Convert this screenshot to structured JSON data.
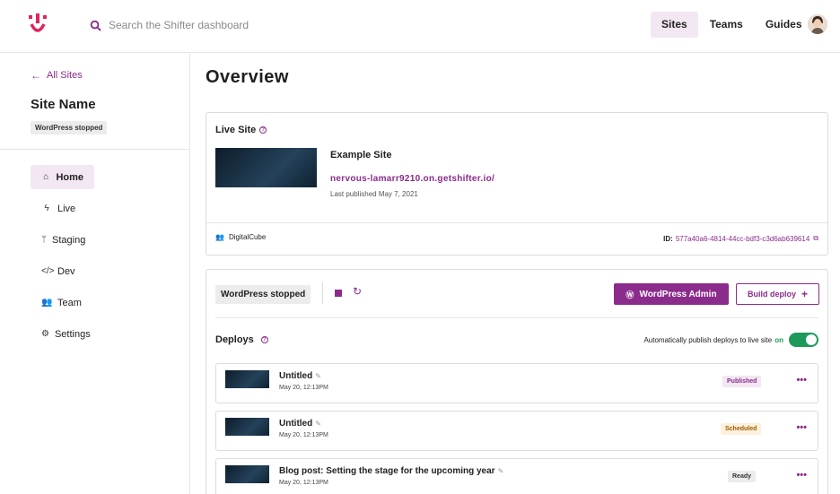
{
  "search": {
    "placeholder": "Search the Shifter dashboard"
  },
  "nav": {
    "sites": "Sites",
    "teams": "Teams",
    "guides": "Guides"
  },
  "sidebar": {
    "back": "All Sites",
    "site_name": "Site Name",
    "status": "WordPress stopped",
    "items": [
      {
        "label": "Home",
        "icon": "home-icon"
      },
      {
        "label": "Live",
        "icon": "bolt-icon"
      },
      {
        "label": "Staging",
        "icon": "branch-icon"
      },
      {
        "label": "Dev",
        "icon": "code-icon"
      },
      {
        "label": "Team",
        "icon": "team-icon"
      },
      {
        "label": "Settings",
        "icon": "gear-icon"
      }
    ]
  },
  "main": {
    "title": "Overview"
  },
  "live": {
    "title": "Live Site",
    "site_title": "Example Site",
    "url": "nervous-lamarr9210.on.getshifter.io/",
    "last_published": "Last published May 7, 2021",
    "team": "DigitalCube",
    "id_label": "ID:",
    "id_value": "577a40a6-4814-44cc-bdf3-c3d6ab639614"
  },
  "deploy": {
    "wp_status": "WordPress stopped",
    "wp_admin": "WordPress Admin",
    "build_deploy": "Build deploy",
    "deploys_title": "Deploys",
    "auto_publish": "Automatically publish deploys to live site",
    "auto_publish_state": "on",
    "rows": [
      {
        "title": "Untitled",
        "date": "May 20, 12:13PM",
        "badge": "Published"
      },
      {
        "title": "Untitled",
        "date": "May 20, 12:13PM",
        "badge": "Scheduled"
      },
      {
        "title": "Blog post: Setting the stage for the upcoming year",
        "date": "May 20, 12:13PM",
        "badge": "Ready"
      }
    ]
  },
  "colors": {
    "brand": "#8b2b8b",
    "toggle_on": "#1d9a5a"
  }
}
